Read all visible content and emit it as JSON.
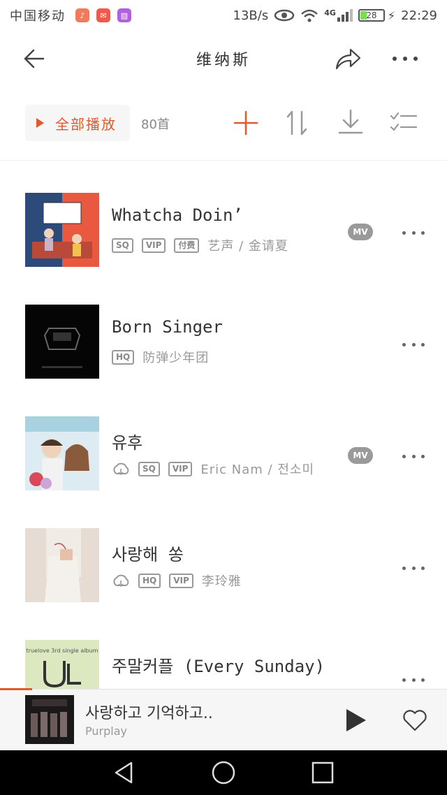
{
  "status_bar": {
    "carrier": "中国移动",
    "speed": "13B/s",
    "network": "4G",
    "battery": "28",
    "time": "22:29"
  },
  "header": {
    "title": "维纳斯"
  },
  "toolbar": {
    "play_all_label": "全部播放",
    "count": "80首"
  },
  "songs": [
    {
      "title": "Whatcha Doin’",
      "tags": [
        "SQ",
        "VIP",
        "付费"
      ],
      "artist": "艺声 / 金请夏",
      "mv": "MV"
    },
    {
      "title": "Born Singer",
      "tags": [
        "HQ"
      ],
      "artist": "防弹少年团"
    },
    {
      "title": "유후",
      "tags": [
        "SQ",
        "VIP"
      ],
      "artist": "Eric Nam / 전소미",
      "mv": "MV"
    },
    {
      "title": "사랑해 쏭",
      "tags": [
        "HQ",
        "VIP"
      ],
      "artist": "李玲雅"
    },
    {
      "title": "주말커플 (Every Sunday)"
    }
  ],
  "now_playing": {
    "title": "사랑하고 기억하고..",
    "artist": "Purplay"
  },
  "colors": {
    "accent": "#e05a2b",
    "mv_badge": "#9a9a9a",
    "navbar": "#000000"
  }
}
